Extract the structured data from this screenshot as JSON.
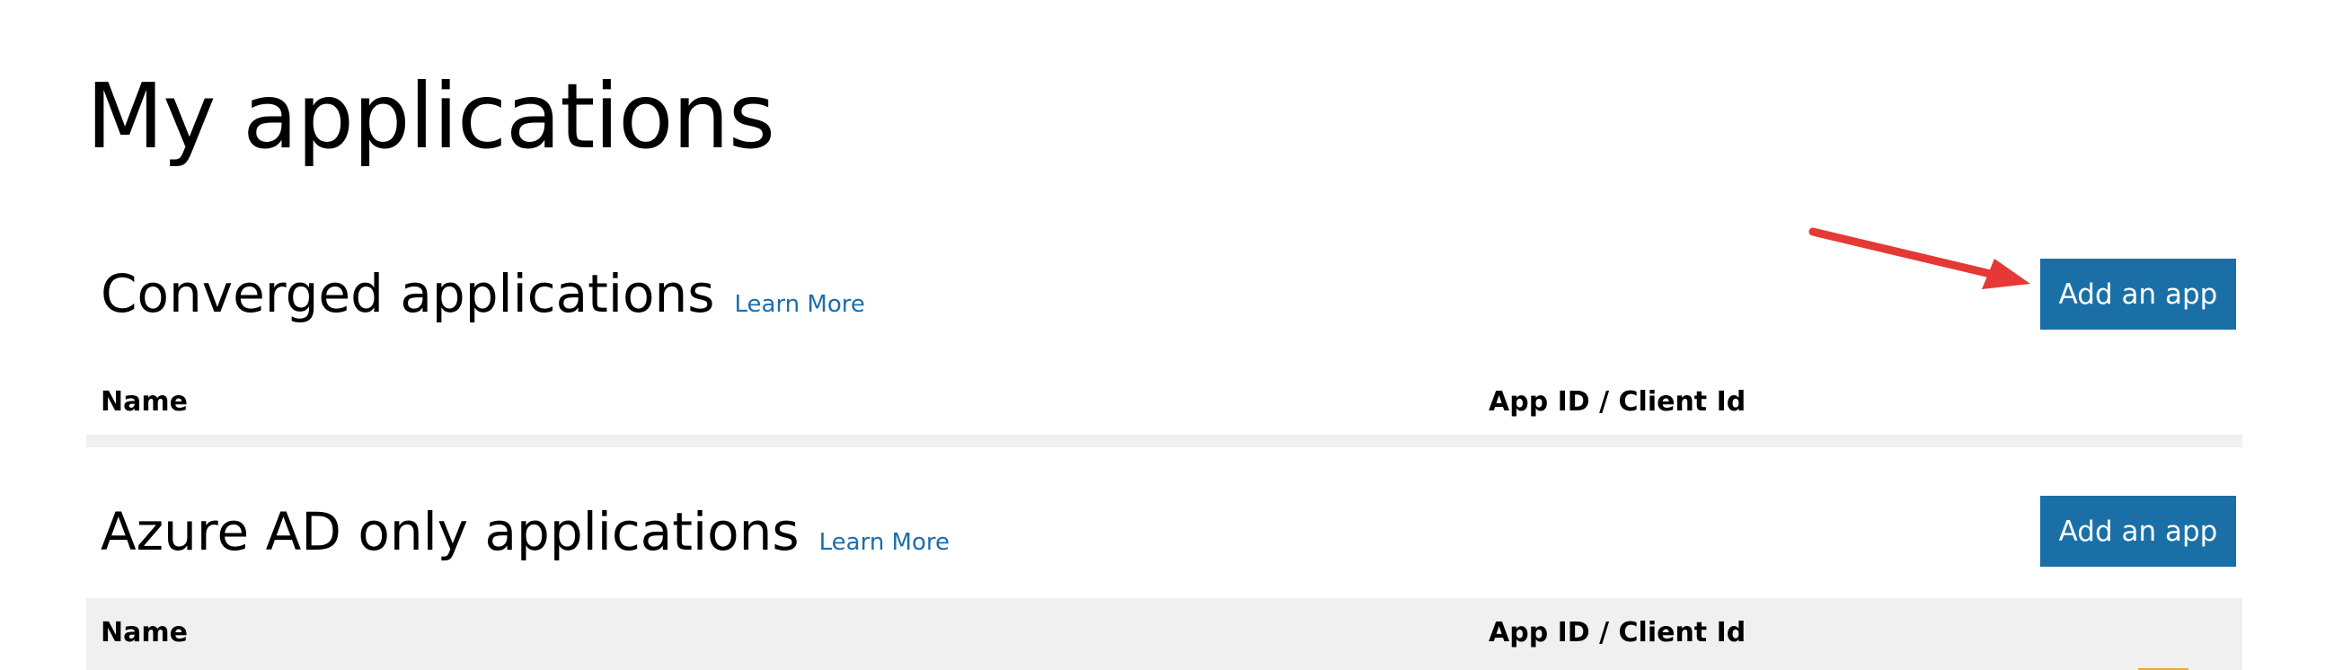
{
  "page": {
    "title": "My applications"
  },
  "sections": [
    {
      "title": "Converged applications",
      "learn_more": "Learn More",
      "add_button": "Add an app",
      "columns": [
        "Name",
        "App ID / Client Id"
      ]
    },
    {
      "title": "Azure AD only applications",
      "learn_more": "Learn More",
      "add_button": "Add an app",
      "columns": [
        "Name",
        "App ID / Client Id"
      ]
    }
  ],
  "colors": {
    "primary_button": "#1b6fa7",
    "link": "#1c6ead",
    "table_header_bg": "#f0f0f0",
    "annotation_arrow": "#e53935"
  },
  "icons": {
    "annotation": "red-arrow-icon"
  }
}
